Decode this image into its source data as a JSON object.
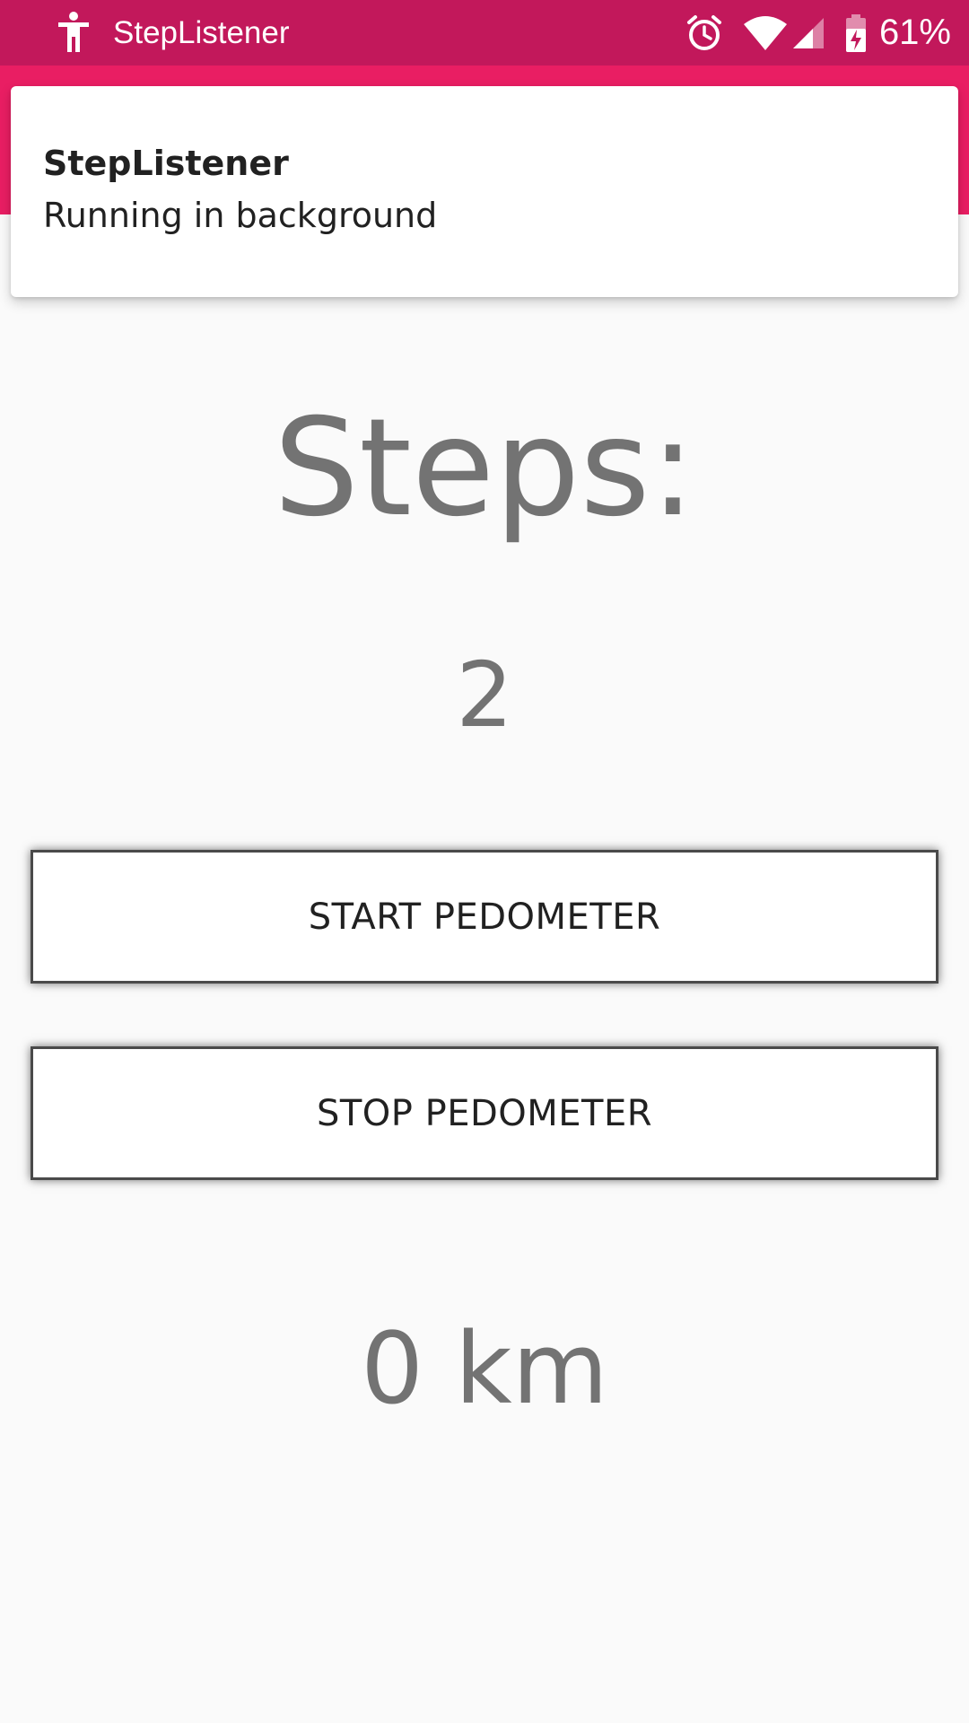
{
  "status_bar": {
    "app_name": "StepListener",
    "battery_percent": "61%",
    "icons": [
      "accessibility-icon",
      "alarm-icon",
      "wifi-icon",
      "cell-signal-icon",
      "battery-charging-icon"
    ],
    "background_color": "#c2185b"
  },
  "app_bar": {
    "color": "#e91e63"
  },
  "notification": {
    "title": "StepListener",
    "text": "Running in background"
  },
  "main": {
    "steps_label": "Steps:",
    "steps_count": "2",
    "start_button": "START PEDOMETER",
    "stop_button": "STOP PEDOMETER",
    "distance": "0 km"
  }
}
